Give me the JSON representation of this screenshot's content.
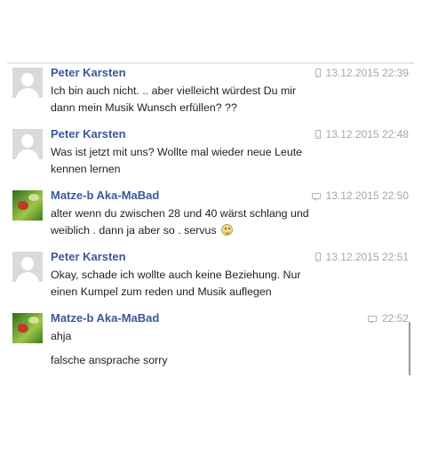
{
  "messages": [
    {
      "sender": "Peter Karsten",
      "avatar": "default-avatar-icon",
      "via": "mobile-icon",
      "timestamp": "13.12.2015 22:39",
      "lines": [
        "Ich bin  auch  nicht. .. aber  vielleicht  würdest  Du mir",
        "dann  mein  Musik  Wunsch  erfüllen? ??"
      ]
    },
    {
      "sender": "Peter Karsten",
      "avatar": "default-avatar-icon",
      "via": "mobile-icon",
      "timestamp": "13.12.2015 22:48",
      "lines": [
        "Was  ist  jetzt  mit  uns? Wollte  mal  wieder  neue  Leute",
        "kennen lernen"
      ]
    },
    {
      "sender": "Matze-b Aka-MaBad",
      "avatar": "user-photo-avatar",
      "via": "chat-icon",
      "timestamp": "13.12.2015 22:50",
      "lines": [
        "alter wenn du zwischen 28 und 40 wärst schlang und",
        "weiblich . dann ja aber so . servus"
      ]
    },
    {
      "sender": "Peter Karsten",
      "avatar": "default-avatar-icon",
      "via": "mobile-icon",
      "timestamp": "13.12.2015 22:51",
      "lines": [
        "Okay,  schade  ich wollte  auch  keine  Beziehung.  Nur",
        "einen  Kumpel  zum reden  und Musik  auflegen"
      ]
    },
    {
      "sender": "Matze-b Aka-MaBad",
      "avatar": "user-photo-avatar",
      "via": "chat-icon",
      "timestamp": "22:52",
      "lines": [
        "ahja",
        "falsche ansprache sorry"
      ]
    }
  ],
  "colors": {
    "sender_name": "#3b5998",
    "timestamp": "#a6a6a6",
    "message_text": "#222222"
  }
}
